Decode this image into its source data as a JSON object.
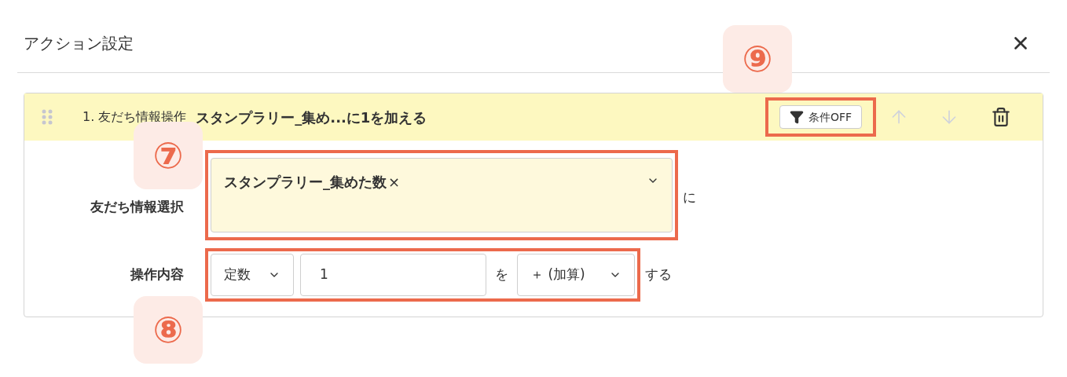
{
  "dialog": {
    "title": "アクション設定"
  },
  "action": {
    "number_label": "1. 友だち情報操作",
    "summary": "スタンプラリー_集め...に1を加える",
    "condition_button": "条件OFF",
    "move_up_disabled": true,
    "move_down_disabled": true,
    "friend_field": {
      "label": "友だち情報選択",
      "tag": "スタンプラリー_集めた数",
      "tag_remove": "×",
      "suffix": "に"
    },
    "operation": {
      "label": "操作内容",
      "type": "定数",
      "value": "1",
      "particle": "を",
      "operator": "＋ (加算)",
      "suffix": "する"
    }
  },
  "annotations": [
    {
      "label": "⑦"
    },
    {
      "label": "⑧"
    },
    {
      "label": "⑨"
    }
  ]
}
